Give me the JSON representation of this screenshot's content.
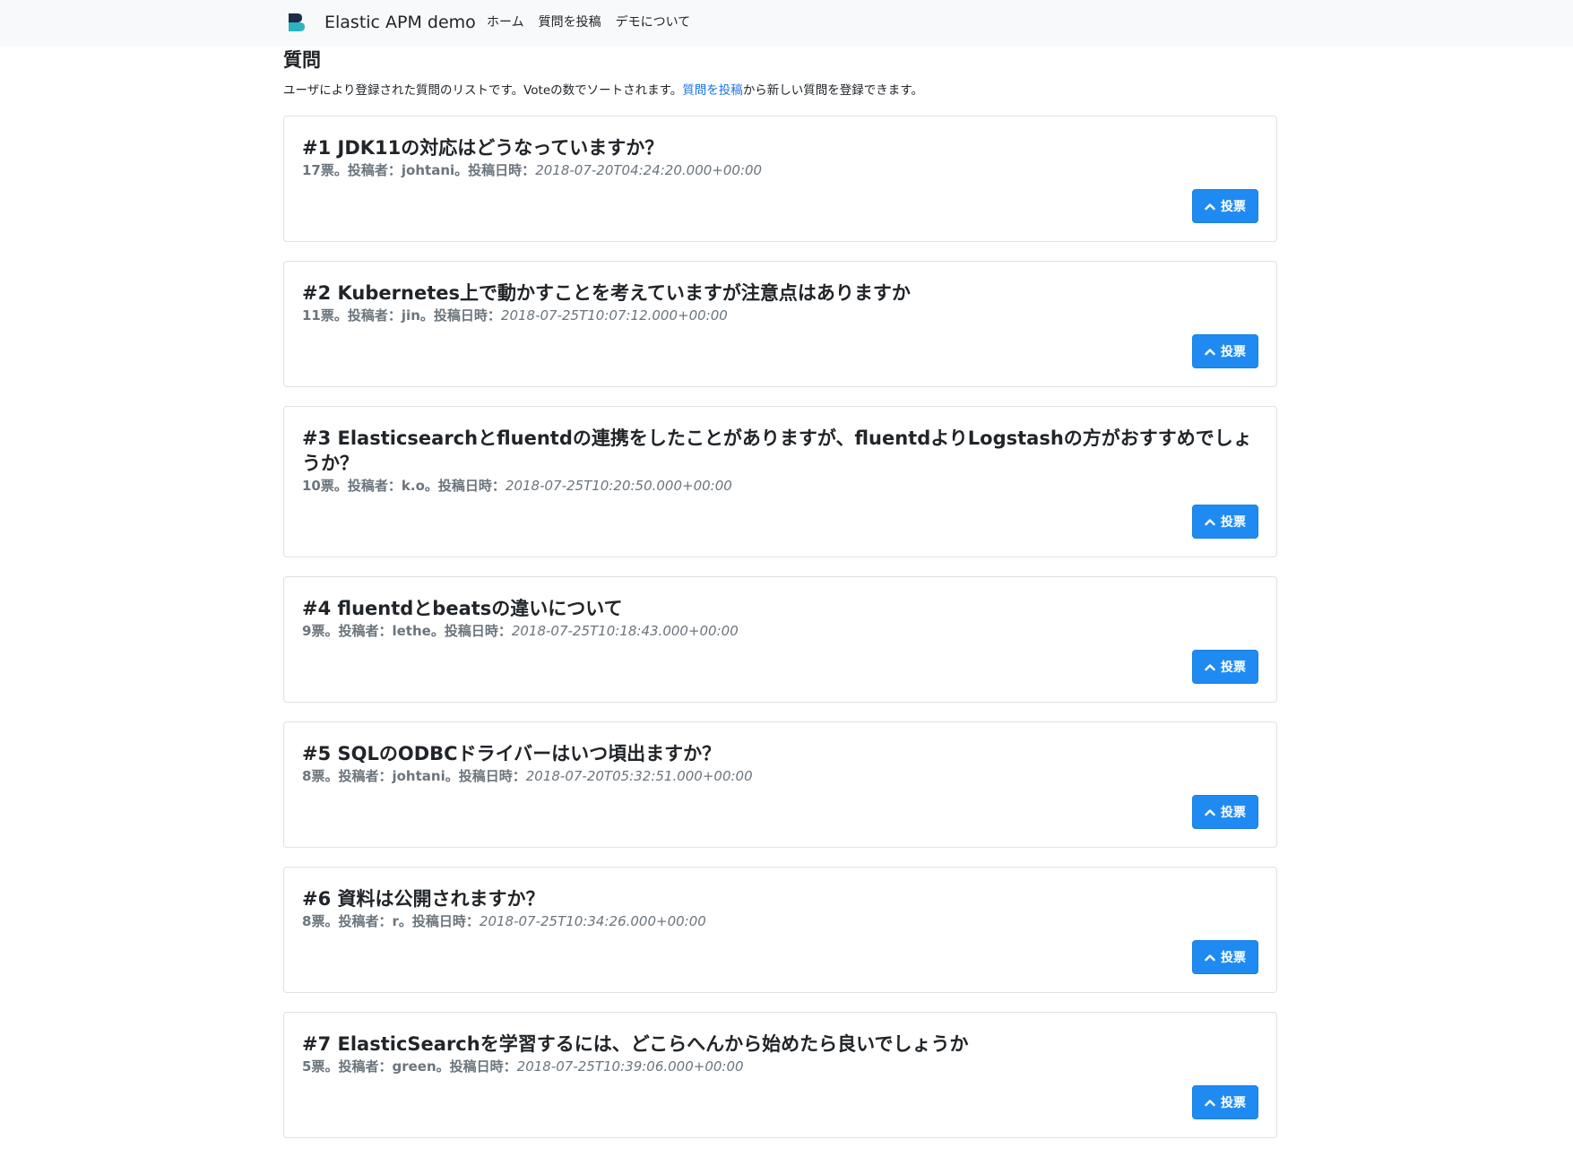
{
  "navbar": {
    "brand": "Elastic APM demo",
    "links": [
      "ホーム",
      "質問を投稿",
      "デモについて"
    ]
  },
  "page": {
    "title": "質問",
    "intro_before": "ユーザにより登録された質問のリストです。Voteの数でソートされます。",
    "intro_link": "質問を投稿",
    "intro_after": "から新しい質問を登録できます。"
  },
  "meta_labels": {
    "votes_suffix": "票。",
    "author_label": "投稿者：",
    "author_suffix": "。",
    "date_label": "投稿日時："
  },
  "questions": [
    {
      "title": "#1 JDK11の対応はどうなっていますか？",
      "votes": "17",
      "author": "johtani",
      "date": "2018-07-20T04:24:20.000+00:00",
      "button": "投票"
    },
    {
      "title": "#2 Kubernetes上で動かすことを考えていますが注意点はありますか",
      "votes": "11",
      "author": "jin",
      "date": "2018-07-25T10:07:12.000+00:00",
      "button": "投票"
    },
    {
      "title": "#3 Elasticsearchとfluentdの連携をしたことがありますが、fluentdよりLogstashの方がおすすめでしょうか？",
      "votes": "10",
      "author": "k.o",
      "date": "2018-07-25T10:20:50.000+00:00",
      "button": "投票"
    },
    {
      "title": "#4 fluentdとbeatsの違いについて",
      "votes": "9",
      "author": "lethe",
      "date": "2018-07-25T10:18:43.000+00:00",
      "button": "投票"
    },
    {
      "title": "#5 SQLのODBCドライバーはいつ頃出ますか？",
      "votes": "8",
      "author": "johtani",
      "date": "2018-07-20T05:32:51.000+00:00",
      "button": "投票"
    },
    {
      "title": "#6 資料は公開されますか？",
      "votes": "8",
      "author": "r",
      "date": "2018-07-25T10:34:26.000+00:00",
      "button": "投票"
    },
    {
      "title": "#7 ElasticSearchを学習するには、どこらへんから始めたら良いでしょうか",
      "votes": "5",
      "author": "green",
      "date": "2018-07-25T10:39:06.000+00:00",
      "button": "投票"
    }
  ],
  "colors": {
    "primary": "#1f8bf2",
    "link": "#1a73e8",
    "muted": "#6c757d",
    "navbar_bg": "#f8f9fa"
  },
  "icons": {
    "brand": "elastic-apm-logo-icon",
    "vote": "chevron-up-icon"
  }
}
